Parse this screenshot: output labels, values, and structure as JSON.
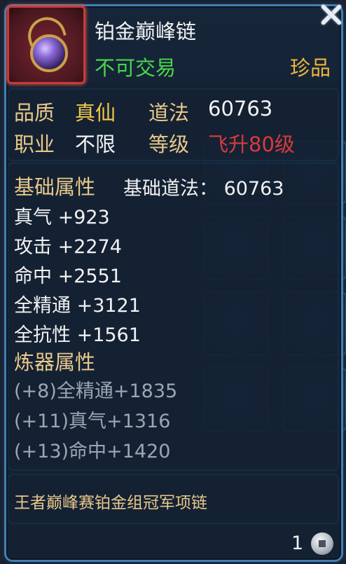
{
  "item": {
    "name": "铂金巅峰链",
    "trade_status": "不可交易",
    "rarity": "珍品"
  },
  "info": {
    "quality_label": "品质",
    "quality_value": "真仙",
    "daofa_label": "道法",
    "daofa_value": "60763",
    "class_label": "职业",
    "class_value": "不限",
    "level_label": "等级",
    "level_value": "飞升80级"
  },
  "base": {
    "section_title": "基础属性",
    "base_daofa": "基础道法：  60763",
    "stats": [
      "真气 +923",
      "攻击 +2274",
      "命中 +2551",
      "全精通 +3121",
      "全抗性 +1561"
    ]
  },
  "refine": {
    "section_title": "炼器属性",
    "stats": [
      "(+8)全精通+1835",
      "(+11)真气+1316",
      "(+13)命中+1420"
    ]
  },
  "description": "王者巅峰赛铂金组冠军项链",
  "footer": {
    "count": "1",
    "currency_icon": "coin-icon"
  },
  "colors": {
    "name": "#f2f2f2",
    "trade": "#49d64a",
    "rarity": "#f0b43c",
    "label_gold": "#e8c88a",
    "value_gold": "#f3c74b",
    "level_red": "#d83a3a",
    "stat_white": "#f2f2f2",
    "refine_grey": "#9aa6b3"
  }
}
